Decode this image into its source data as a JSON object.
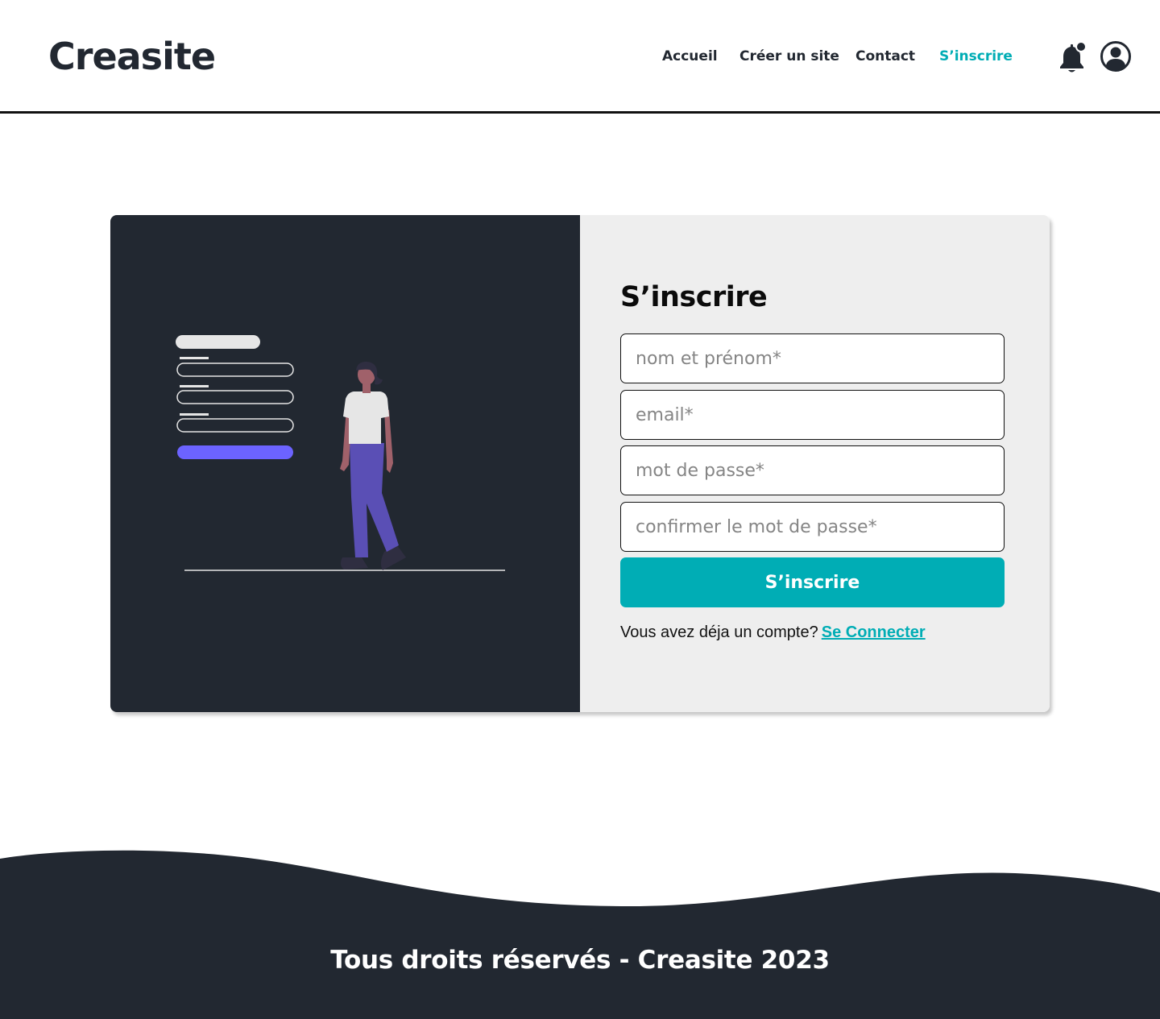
{
  "brand": {
    "name": "Creasite"
  },
  "nav": {
    "items": [
      {
        "label": "Accueil",
        "active": false
      },
      {
        "label": "Créer un site",
        "active": false
      },
      {
        "label": "Contact",
        "active": false
      },
      {
        "label": "S’inscrire",
        "active": true
      }
    ],
    "icons": [
      "bell-notification-icon",
      "user-account-icon"
    ]
  },
  "signup": {
    "title": "S’inscrire",
    "fields": {
      "name_placeholder": "nom et prénom*",
      "email_placeholder": "email*",
      "password_placeholder": "mot de passe*",
      "confirm_placeholder": "confirmer le mot de passe*"
    },
    "submit_label": "S’inscrire",
    "login_prompt": "Vous avez déja un compte?",
    "login_link": "Se Connecter"
  },
  "footer": {
    "text": "Tous droits réservés - Creasite 2023"
  },
  "colors": {
    "accent": "#00adb5",
    "dark": "#222831",
    "panel": "#eeeeee",
    "illustration_button": "#6c63ff",
    "illustration_pants": "#5a4fb5"
  }
}
